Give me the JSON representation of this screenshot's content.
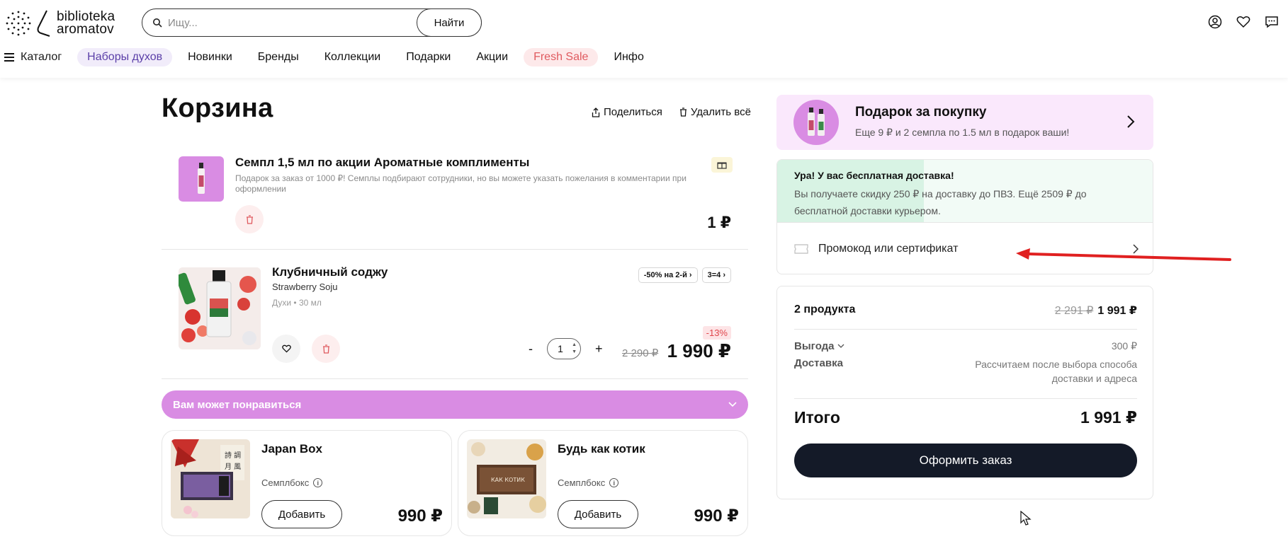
{
  "brand": {
    "line1": "biblioteka",
    "line2": "aromatov"
  },
  "search": {
    "placeholder": "Ищу...",
    "button": "Найти"
  },
  "header_icons": [
    "user-icon",
    "heart-icon",
    "chat-icon"
  ],
  "nav": {
    "catalog": "Каталог",
    "items": [
      "Наборы духов",
      "Новинки",
      "Бренды",
      "Коллекции",
      "Подарки",
      "Акции",
      "Fresh Sale",
      "Инфо"
    ]
  },
  "cart": {
    "title": "Корзина",
    "share": "Поделиться",
    "delete_all": "Удалить всё",
    "items": [
      {
        "title": "Семпл 1,5 мл по акции Ароматные комплименты",
        "description": "Подарок за заказ от 1000 ₽! Семплы подбирают сотрудники, но вы можете указать пожелания в комментарии при оформлении",
        "price": "1 ₽"
      },
      {
        "title": "Клубничный соджу",
        "subtitle": "Strawberry Soju",
        "meta": "Духи • 30 мл",
        "tags": [
          "-50% на 2-й",
          "3=4"
        ],
        "quantity": "1",
        "qty_minus": "-",
        "qty_plus": "+",
        "old_price": "2 290 ₽",
        "price": "1 990 ₽",
        "discount": "-13%"
      }
    ]
  },
  "recommend": {
    "title": "Вам может понравиться",
    "cards": [
      {
        "title": "Japan Box",
        "type": "Семплбокс",
        "button": "Добавить",
        "price": "990 ₽"
      },
      {
        "title": "Будь как котик",
        "type": "Семплбокс",
        "button": "Добавить",
        "price": "990 ₽"
      }
    ]
  },
  "gift_panel": {
    "title": "Подарок за покупку",
    "subtitle": "Еще 9 ₽ и 2 семпла по 1.5 мл в подарок ваши!"
  },
  "delivery": {
    "title": "Ура! У вас бесплатная доставка!",
    "text": "Вы получаете скидку 250 ₽ на доставку до ПВЗ. Ещё 2509 ₽ до бесплатной доставки курьером.",
    "progress_fraction": 0.39,
    "promo_label": "Промокод или сертификат"
  },
  "summary": {
    "products_label": "2 продукта",
    "products_old": "2 291 ₽",
    "products_price": "1 991 ₽",
    "benefit_label": "Выгода",
    "benefit_value": "300 ₽",
    "delivery_label": "Доставка",
    "delivery_value": "Рассчитаем после выбора способа доставки и адреса",
    "total_label": "Итого",
    "total_value": "1 991 ₽",
    "order_button": "Оформить заказ"
  },
  "colors": {
    "accent_purple": "#d98ce3",
    "dark_button": "#141a28",
    "annotation_arrow": "#e02020",
    "delivery_green": "#d8f3e4"
  }
}
